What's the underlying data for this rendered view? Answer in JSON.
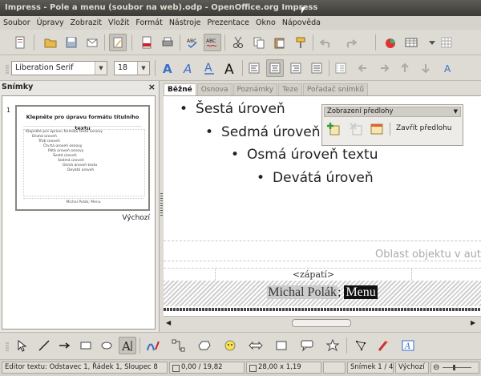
{
  "window": {
    "title": "Impress - Pole a menu (soubor na web).odp - OpenOffice.org Impress"
  },
  "menu": [
    "Soubor",
    "Úpravy",
    "Zobrazit",
    "Vložit",
    "Formát",
    "Nástroje",
    "Prezentace",
    "Okno",
    "Nápověda"
  ],
  "formatting": {
    "font_name": "Liberation Serif",
    "font_size": "18"
  },
  "slides_pane": {
    "title": "Snímky",
    "close_glyph": "×",
    "slide_number": "1",
    "thumb_title": "Klepněte pro úpravu formátu titulního textu",
    "thumb_lines": [
      "Klepněte pro úpravu formátu textu osnovy",
      "Druhá úroveň",
      "Třetí úroveň",
      "Čtvrtá úroveň osnovy",
      "Pátá úroveň osnovy",
      "Šestá úroveň",
      "Sedmá úroveň",
      "Osmá úroveň textu",
      "Devátá úroveň"
    ],
    "thumb_footer": [
      "Michal Polák; Menu"
    ],
    "master_name": "Výchozí"
  },
  "tabs": [
    {
      "label": "Běžné",
      "active": true
    },
    {
      "label": "Osnova",
      "active": false
    },
    {
      "label": "Poznámky",
      "active": false
    },
    {
      "label": "Teze",
      "active": false
    },
    {
      "label": "Pořadač snímků",
      "active": false
    }
  ],
  "canvas": {
    "bullets": [
      "Šestá úroveň",
      "Sedmá úroveň",
      "Osmá úroveň textu",
      "Devátá úroveň"
    ],
    "bullet_glyph": "•",
    "object_area_label": "Oblast objektu v aut",
    "footer_placeholder": "<zápatí>",
    "footer_text_name": "Michal Polák",
    "footer_text_separator": ";",
    "footer_text_selected": "Menu"
  },
  "master_view_panel": {
    "title": "Zobrazení předlohy",
    "close_button": "Zavřít předlohu"
  },
  "status": {
    "edit_info": "Editor textu: Odstavec 1, Řádek 1, Sloupec 8",
    "position": "0,00 / 19,82",
    "size": "28,00 x 1,19",
    "slide": "Snímek 1 / 4",
    "master": "Výchozí"
  },
  "colors": {
    "titlebar": "#3c3b37",
    "accent": "#f07746",
    "canvas": "#ffffff"
  }
}
